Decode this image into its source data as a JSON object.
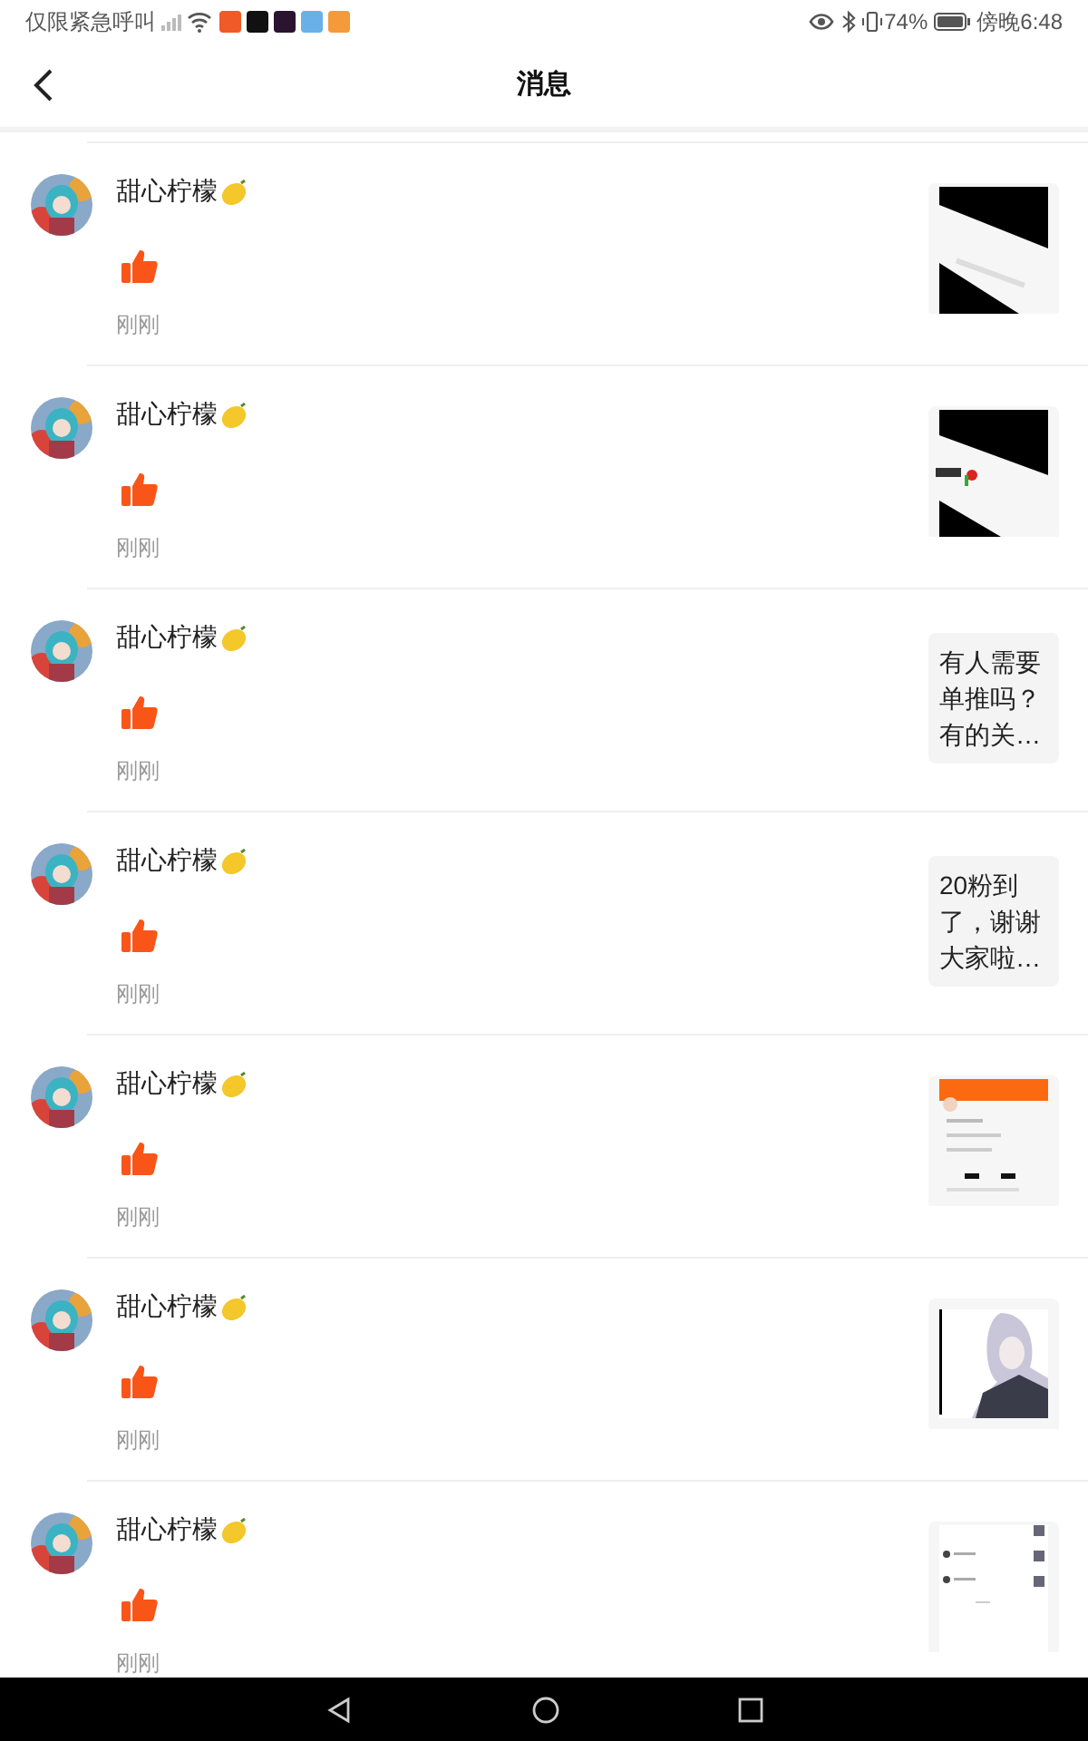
{
  "status_bar": {
    "carrier": "仅限紧急呼叫",
    "battery_text": "74%",
    "time": "傍晚6:48"
  },
  "header": {
    "title": "消息"
  },
  "messages": [
    {
      "name": "甜心柠檬",
      "time": "刚刚"
    },
    {
      "name": "甜心柠檬",
      "time": "刚刚"
    },
    {
      "name": "甜心柠檬",
      "time": "刚刚",
      "preview": {
        "kind": "text",
        "text": "有人需要单推吗？有的关…"
      }
    },
    {
      "name": "甜心柠檬",
      "time": "刚刚",
      "preview": {
        "kind": "text",
        "text": "20粉到了，谢谢大家啦…"
      }
    },
    {
      "name": "甜心柠檬",
      "time": "刚刚"
    },
    {
      "name": "甜心柠檬",
      "time": "刚刚"
    },
    {
      "name": "甜心柠檬",
      "time": "刚刚"
    }
  ]
}
